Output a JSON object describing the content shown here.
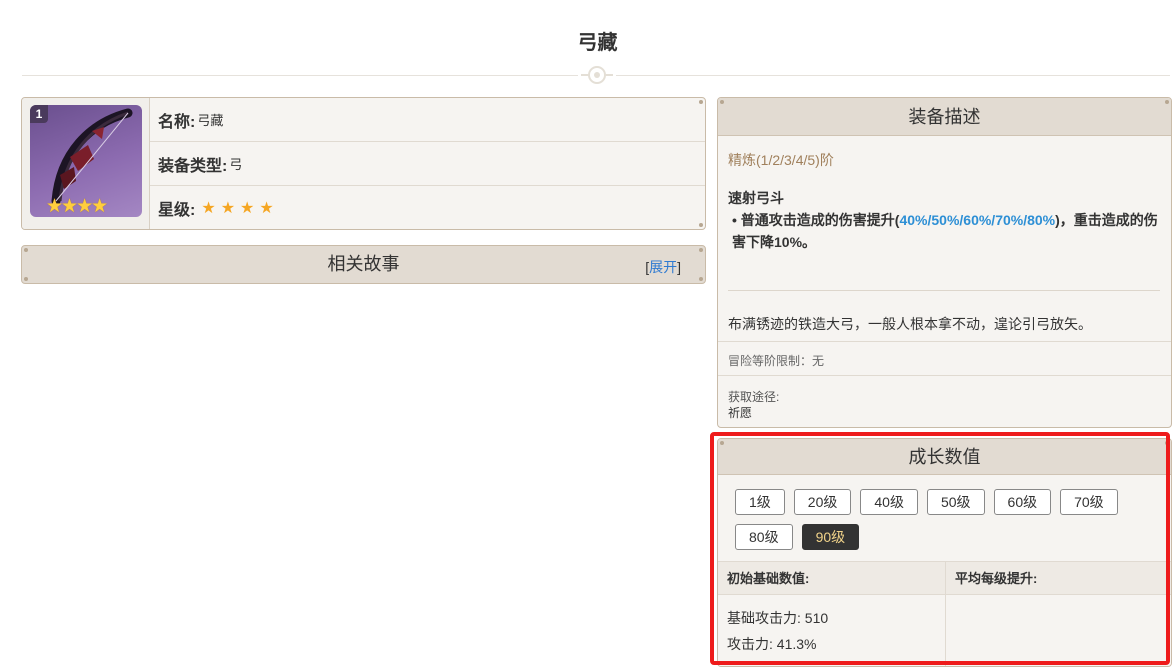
{
  "page": {
    "title": "弓藏"
  },
  "info": {
    "rank_badge": "1",
    "image_stars": "★★★★",
    "name_label": "名称:",
    "name_value": "弓藏",
    "type_label": "装备类型:",
    "type_value": "弓",
    "rarity_label": "星级:",
    "rarity_stars": 4
  },
  "story": {
    "title": "相关故事",
    "bracket_open": "[",
    "toggle_label": "展开",
    "bracket_close": "]"
  },
  "description": {
    "header": "装备描述",
    "refine_label": "精炼(1/2/3/4/5)阶",
    "skill_name": "速射弓斗",
    "skill_bullet": "•",
    "skill_text_before": "普通攻击造成的伤害提升(",
    "skill_values": "40%/50%/60%/70%/80%",
    "skill_text_after": ")，重击造成的伤害下降10%。",
    "lore": "布满锈迹的铁造大弓，一般人根本拿不动，遑论引弓放矢。",
    "limit": "冒险等阶限制：无",
    "obtain_label": "获取途径:",
    "obtain_value": "祈愿"
  },
  "growth": {
    "header": "成长数值",
    "levels": [
      "1级",
      "20级",
      "40级",
      "50级",
      "60级",
      "70级",
      "80级",
      "90级"
    ],
    "selected_level": "90级",
    "col_initial": "初始基础数值:",
    "col_avg": "平均每级提升:",
    "stat_base_atk": "基础攻击力: 510",
    "stat_atk": "攻击力: 41.3%"
  },
  "colors": {
    "highlight": "#ee1b1b",
    "accent_blue": "#2d8fd5",
    "refine_brown": "#a0805c",
    "star_gold": "#f5a623"
  }
}
